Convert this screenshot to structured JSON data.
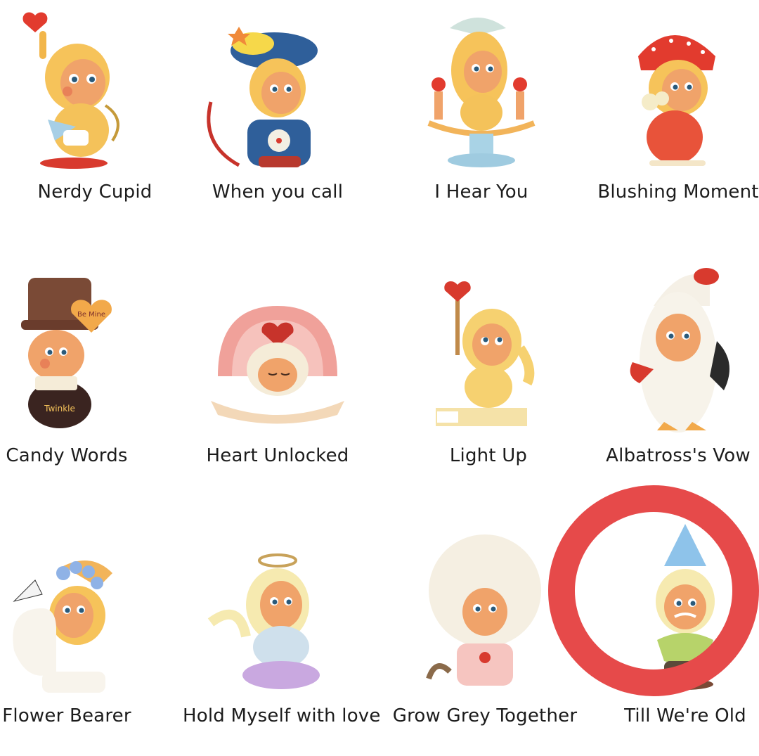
{
  "items": [
    {
      "name": "Nerdy Cupid"
    },
    {
      "name": "When you call"
    },
    {
      "name": "I Hear You"
    },
    {
      "name": "Blushing Moment"
    },
    {
      "name": "Candy Words"
    },
    {
      "name": "Heart Unlocked"
    },
    {
      "name": "Light Up"
    },
    {
      "name": "Albatross's Vow"
    },
    {
      "name": "Flower Bearer"
    },
    {
      "name": "Hold Myself with love"
    },
    {
      "name": "Grow Grey Together"
    },
    {
      "name": "Till We're Old"
    }
  ],
  "figures": {
    "decor_text": {
      "candy_words_balloon": "Be Mine",
      "candy_words_base": "Twinkle"
    }
  },
  "colors": {
    "highlight_ring": "#e64a4a",
    "skin": "#f0a36a",
    "blush": "#e26a4c",
    "hood_yellow": "#f4c25a"
  }
}
